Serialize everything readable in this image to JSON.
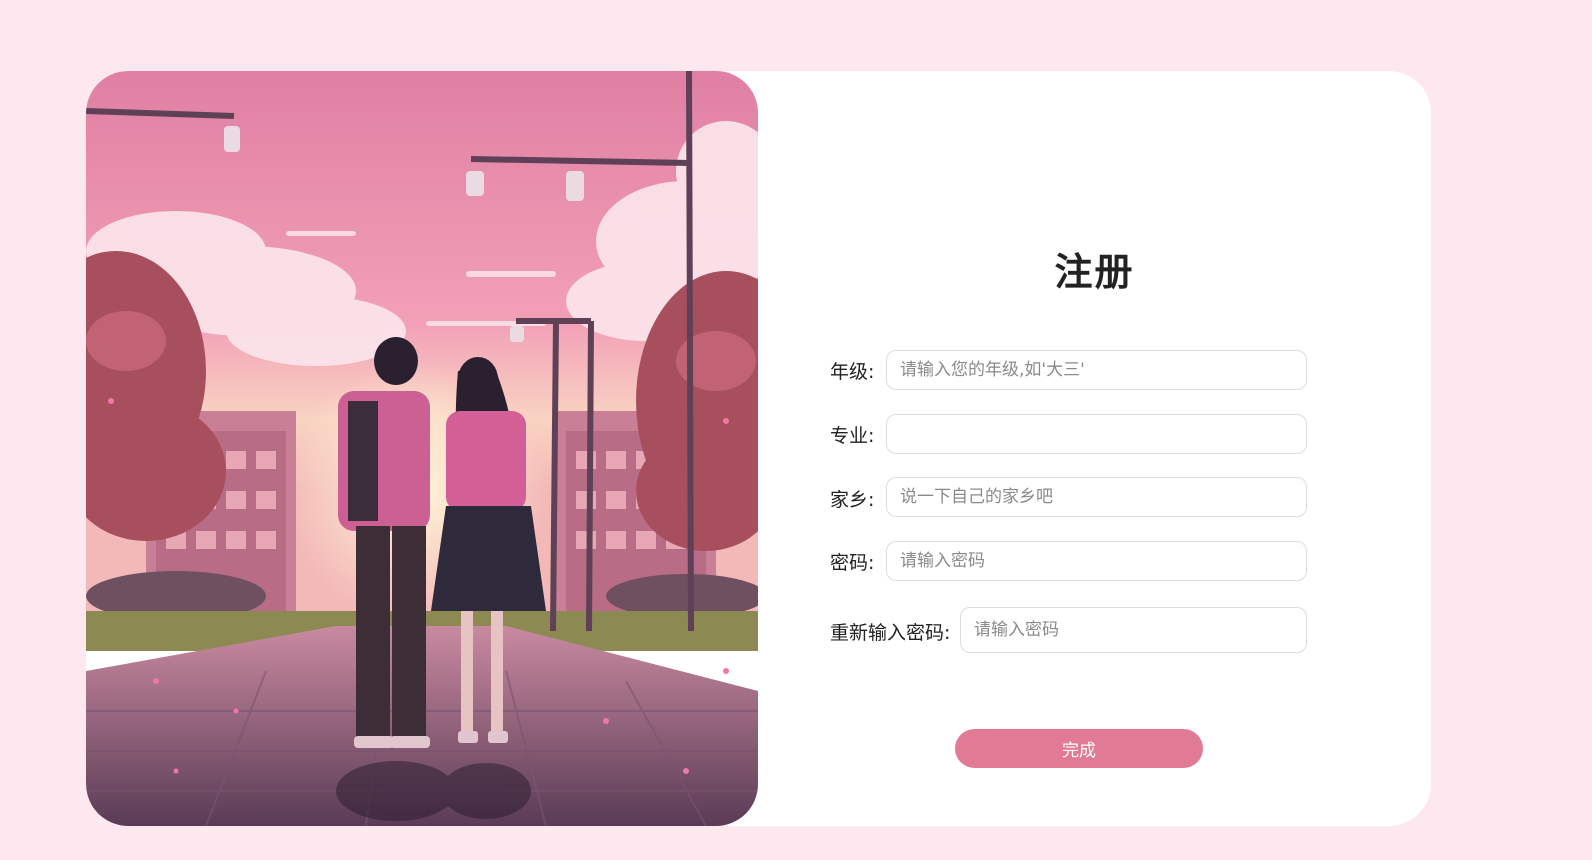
{
  "form": {
    "title": "注册",
    "fields": [
      {
        "label": "年级:",
        "placeholder": "请输入您的年级,如'大三'",
        "value": ""
      },
      {
        "label": "专业:",
        "placeholder": "",
        "value": ""
      },
      {
        "label": "家乡:",
        "placeholder": "说一下自己的家乡吧",
        "value": ""
      },
      {
        "label": "密码:",
        "placeholder": "请输入密码",
        "value": ""
      },
      {
        "label": "重新输入密码:",
        "placeholder": "请输入密码",
        "value": ""
      }
    ],
    "submit_label": "完成"
  },
  "theme": {
    "page_background": "#fde8ef",
    "accent": "#e07a95",
    "card_background": "#ffffff"
  },
  "hero": {
    "description_icon": "illustration-couple-walking"
  }
}
